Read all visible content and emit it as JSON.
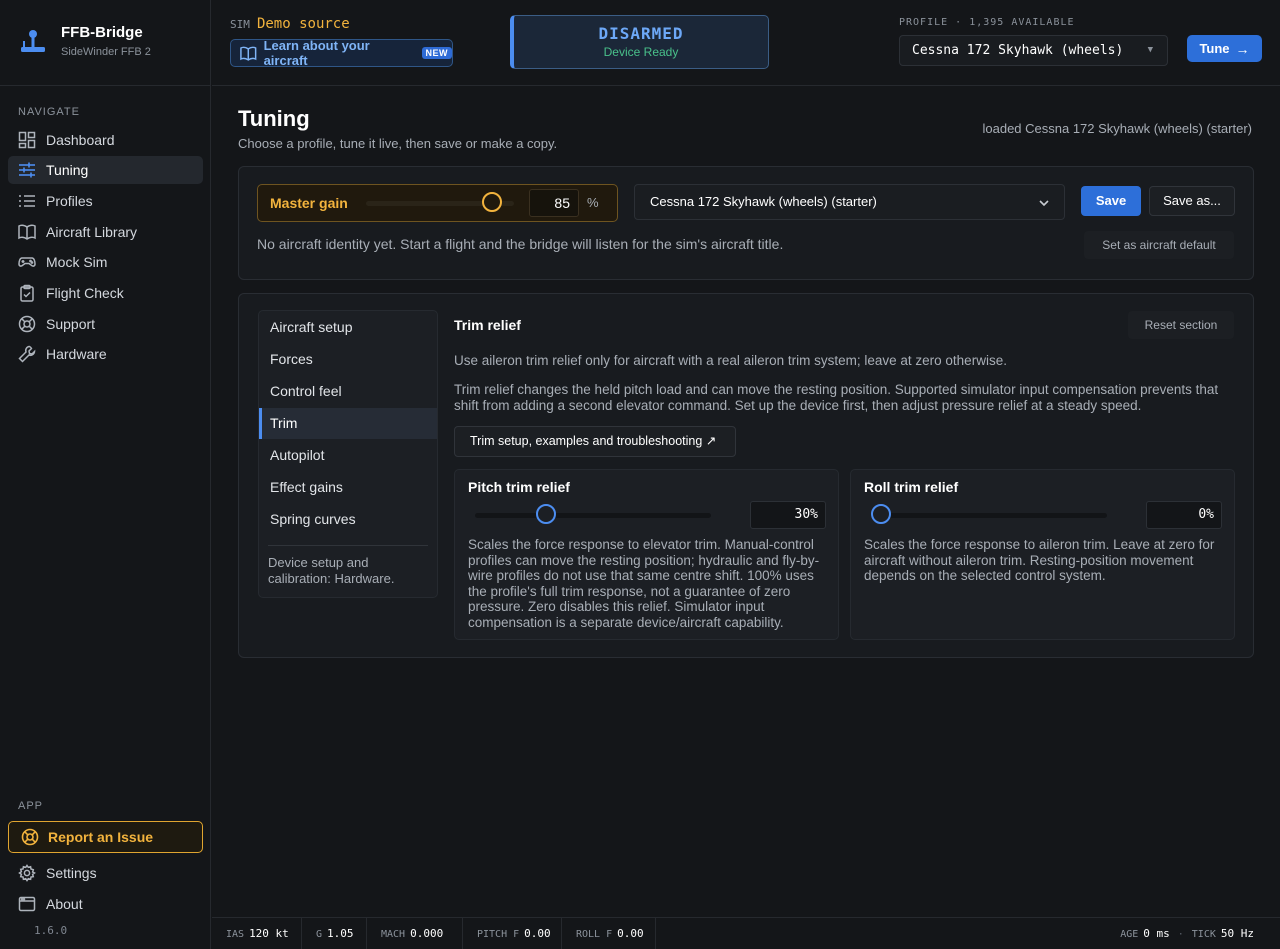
{
  "brand": {
    "title": "FFB-Bridge",
    "subtitle": "SideWinder FFB 2"
  },
  "nav": {
    "caption": "NAVIGATE",
    "items": [
      {
        "label": "Dashboard",
        "icon": "dashboard-icon"
      },
      {
        "label": "Tuning",
        "icon": "sliders-icon",
        "active": true
      },
      {
        "label": "Profiles",
        "icon": "list-icon"
      },
      {
        "label": "Aircraft Library",
        "icon": "book-icon"
      },
      {
        "label": "Mock Sim",
        "icon": "gamepad-icon"
      },
      {
        "label": "Flight Check",
        "icon": "clipboard-check-icon"
      },
      {
        "label": "Support",
        "icon": "lifebuoy-icon"
      },
      {
        "label": "Hardware",
        "icon": "wrench-icon"
      }
    ],
    "app_caption": "APP",
    "report_label": "Report an Issue",
    "settings_label": "Settings",
    "about_label": "About",
    "version": "1.6.0"
  },
  "topbar": {
    "sim_caption": "SIM",
    "sim_value": "Demo source",
    "learn_label": "Learn about your aircraft",
    "learn_badge": "NEW",
    "status_title": "DISARMED",
    "status_sub": "Device Ready",
    "profile_caption": "PROFILE · 1,395 AVAILABLE",
    "profile_value": "Cessna 172 Skyhawk (wheels)",
    "tune_label": "Tune"
  },
  "page": {
    "title": "Tuning",
    "subtitle": "Choose a profile, tune it live, then save or make a copy.",
    "loaded": "loaded Cessna 172 Skyhawk (wheels) (starter)"
  },
  "top_card": {
    "gain_label": "Master gain",
    "gain_value": "85",
    "gain_level": 0.85,
    "gain_unit": "%",
    "profile_dd": "Cessna 172 Skyhawk (wheels) (starter)",
    "save_label": "Save",
    "save_as_label": "Save as...",
    "identity_msg": "No aircraft identity yet. Start a flight and the bridge will listen for the sim's aircraft title.",
    "default_label": "Set as aircraft default"
  },
  "sections": {
    "items": [
      "Aircraft setup",
      "Forces",
      "Control feel",
      "Trim",
      "Autopilot",
      "Effect gains",
      "Spring curves"
    ],
    "active": "Trim",
    "note": "Device setup and calibration: Hardware."
  },
  "trim": {
    "title": "Trim relief",
    "reset_label": "Reset section",
    "p1": "Use aileron trim relief only for aircraft with a real aileron trim system; leave at zero otherwise.",
    "p2": "Trim relief changes the held pitch load and can move the resting position. Supported simulator input compensation prevents that shift from adding a second elevator command. Set up the device first, then adjust pressure relief at a steady speed.",
    "guide_label": "Trim setup, examples and troubleshooting ↗",
    "pitch": {
      "title": "Pitch trim relief",
      "value": "30%",
      "level": 0.3,
      "desc": "Scales the force response to elevator trim. Manual-control profiles can move the resting position; hydraulic and fly-by-wire profiles do not use that same centre shift. 100% uses the profile's full trim response, not a guarantee of zero pressure. Zero disables this relief. Simulator input compensation is a separate device/aircraft capability."
    },
    "roll": {
      "title": "Roll trim relief",
      "value": "0%",
      "level": 0.0,
      "desc": "Scales the force response to aileron trim. Leave at zero for aircraft without aileron trim. Resting-position movement depends on the selected control system."
    }
  },
  "statusbar": {
    "ias_label": "IAS",
    "ias_value": "120 kt",
    "g_label": "G",
    "g_value": "1.05",
    "mach_label": "MACH",
    "mach_value": "0.000",
    "pitchf_label": "PITCH F",
    "pitchf_value": "0.00",
    "rollf_label": "ROLL F",
    "rollf_value": "0.00",
    "age_label": "AGE",
    "age_value": "0 ms",
    "tick_label": "TICK",
    "tick_value": "50 Hz"
  },
  "colors": {
    "accent": "#2d6fd9",
    "warning": "#f2b33d",
    "ready": "#49c08a"
  }
}
